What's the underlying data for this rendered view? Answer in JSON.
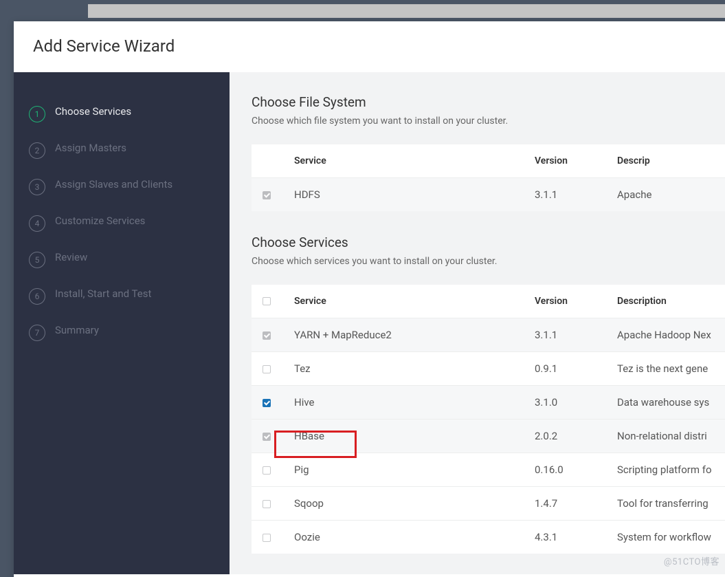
{
  "modal": {
    "title": "Add Service Wizard"
  },
  "steps": [
    {
      "n": "1",
      "label": "Choose Services",
      "active": true
    },
    {
      "n": "2",
      "label": "Assign Masters"
    },
    {
      "n": "3",
      "label": "Assign Slaves and Clients"
    },
    {
      "n": "4",
      "label": "Customize Services"
    },
    {
      "n": "5",
      "label": "Review"
    },
    {
      "n": "6",
      "label": "Install, Start and Test"
    },
    {
      "n": "7",
      "label": "Summary"
    }
  ],
  "filesys": {
    "title": "Choose File System",
    "sub": "Choose which file system you want to install on your cluster.",
    "headers": {
      "service": "Service",
      "version": "Version",
      "desc": "Descrip"
    },
    "rows": [
      {
        "selected": "locked",
        "service": "HDFS",
        "version": "3.1.1",
        "desc": "Apache"
      }
    ]
  },
  "services": {
    "title": "Choose Services",
    "sub": "Choose which services you want to install on your cluster.",
    "headers": {
      "service": "Service",
      "version": "Version",
      "desc": "Description"
    },
    "rows": [
      {
        "selected": "locked",
        "service": "YARN + MapReduce2",
        "version": "3.1.1",
        "desc": "Apache Hadoop Nex"
      },
      {
        "selected": "none",
        "service": "Tez",
        "version": "0.9.1",
        "desc": "Tez is the next gene"
      },
      {
        "selected": "checked",
        "service": "Hive",
        "version": "3.1.0",
        "desc": "Data warehouse sys"
      },
      {
        "selected": "locked",
        "service": "HBase",
        "version": "2.0.2",
        "desc": "Non-relational distri"
      },
      {
        "selected": "none",
        "service": "Pig",
        "version": "0.16.0",
        "desc": "Scripting platform fo"
      },
      {
        "selected": "none",
        "service": "Sqoop",
        "version": "1.4.7",
        "desc": "Tool for transferring"
      },
      {
        "selected": "none",
        "service": "Oozie",
        "version": "4.3.1",
        "desc": "System for workflow"
      }
    ]
  },
  "watermark": "@51CTO博客"
}
